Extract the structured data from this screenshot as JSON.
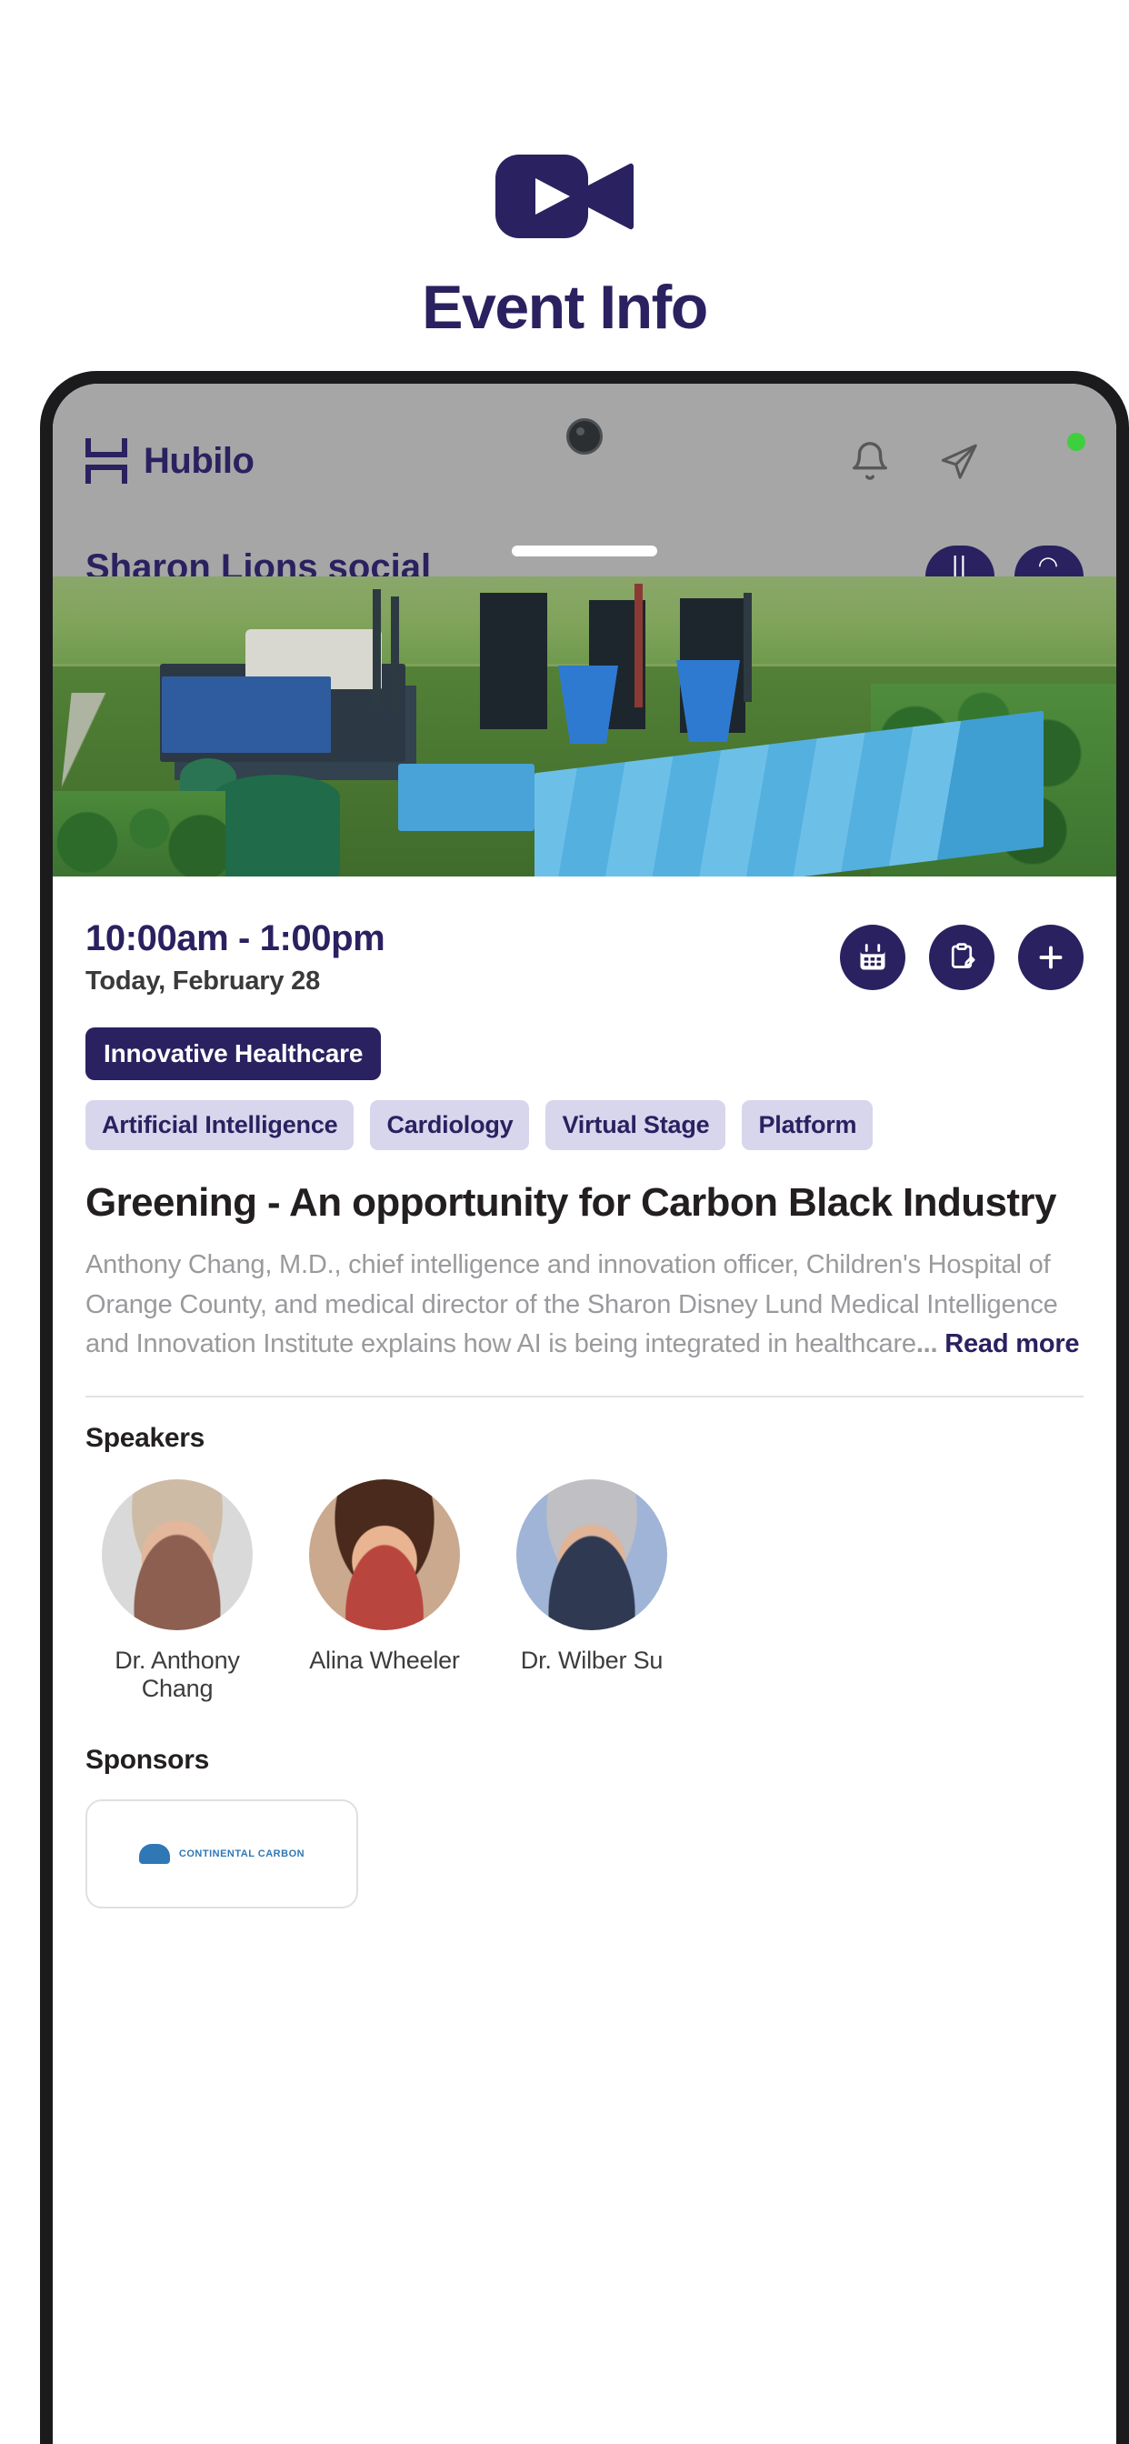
{
  "brand": {
    "icon": "video-camera-icon",
    "title": "Event Info",
    "accent_navy": "#2A2160"
  },
  "app": {
    "topbar": {
      "logo_mark": "hubilo-logo-icon",
      "logo_text": "Hubilo",
      "notification_icon": "bell-icon",
      "send_icon": "paper-plane-icon",
      "avatar": "user-avatar",
      "online_status_color": "#3ECF3E"
    },
    "hidden_header": {
      "title": "Sharon Lions social",
      "action_1": "pause-icon",
      "action_2": "headset-icon"
    },
    "hero": {
      "alt": "aerial-view-of-carbon-black-industrial-plant"
    },
    "session": {
      "time": "10:00am - 1:00pm",
      "date": "Today, February 28",
      "actions": [
        {
          "name": "add-to-calendar-button",
          "icon": "calendar-icon"
        },
        {
          "name": "notes-button",
          "icon": "clipboard-edit-icon"
        },
        {
          "name": "add-button",
          "icon": "plus-icon"
        }
      ],
      "primary_tag": "Innovative Healthcare",
      "tags": [
        "Artificial Intelligence",
        "Cardiology",
        "Virtual Stage",
        "Platform"
      ],
      "title": "Greening - An opportunity for Carbon Black Industry",
      "description": "Anthony Chang, M.D., chief intelligence and innovation officer, Children's Hospital of Orange County, and medical director of the Sharon Disney Lund Medical Intelligence and Innovation Institute explains how AI is being integrated in healthcare",
      "description_ellipsis": "...",
      "read_more": "Read more"
    },
    "speakers": {
      "label": "Speakers",
      "list": [
        {
          "name": "Dr. Anthony Chang"
        },
        {
          "name": "Alina Wheeler"
        },
        {
          "name": "Dr. Wilber Su"
        }
      ]
    },
    "sponsors": {
      "label": "Sponsors",
      "items": [
        {
          "logo_text": "CONTINENTAL CARBON"
        }
      ]
    }
  }
}
